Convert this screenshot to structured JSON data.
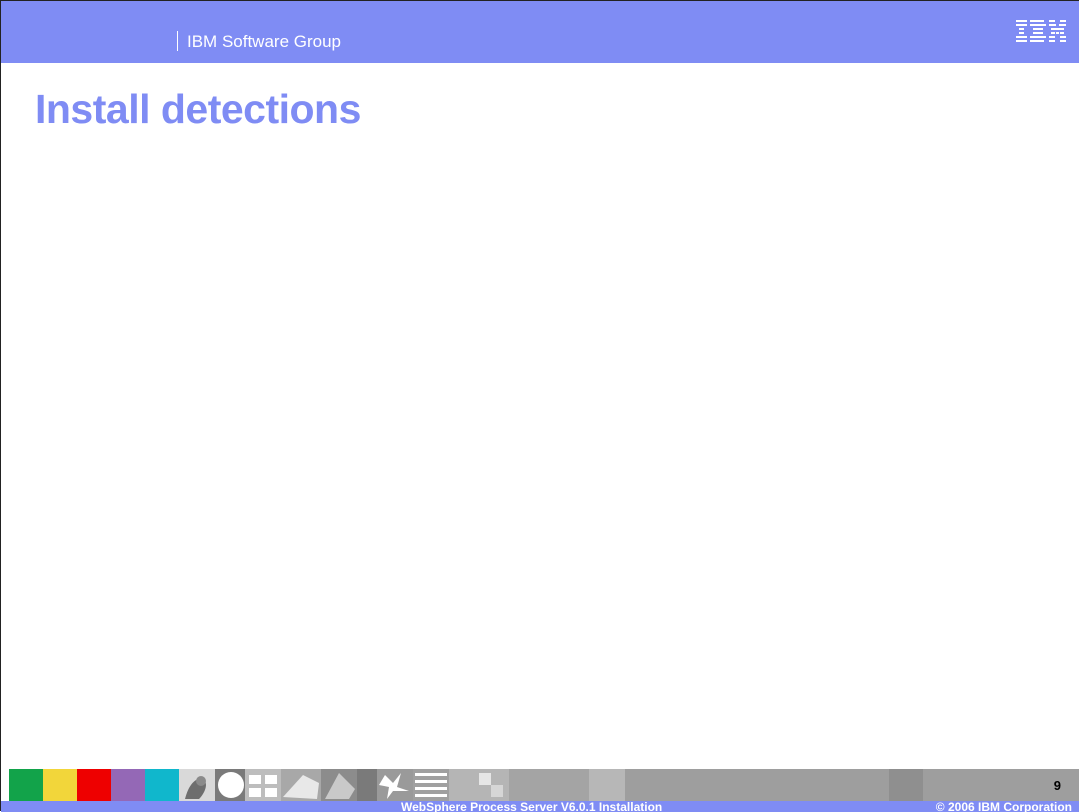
{
  "header": {
    "group_label": "IBM Software Group",
    "logo_text": "IBM"
  },
  "slide": {
    "title": "Install detections",
    "page_number": "9"
  },
  "footer": {
    "course_title": "WebSphere Process Server V6.0.1 Installation",
    "copyright": "© 2006 IBM Corporation"
  },
  "colors": {
    "header_bg": "#7f8cf4",
    "title": "#7f8cf4",
    "strip_swatches": [
      "#12a34a",
      "#f2d63a",
      "#ee0000",
      "#9468b6",
      "#10b7cc"
    ]
  }
}
